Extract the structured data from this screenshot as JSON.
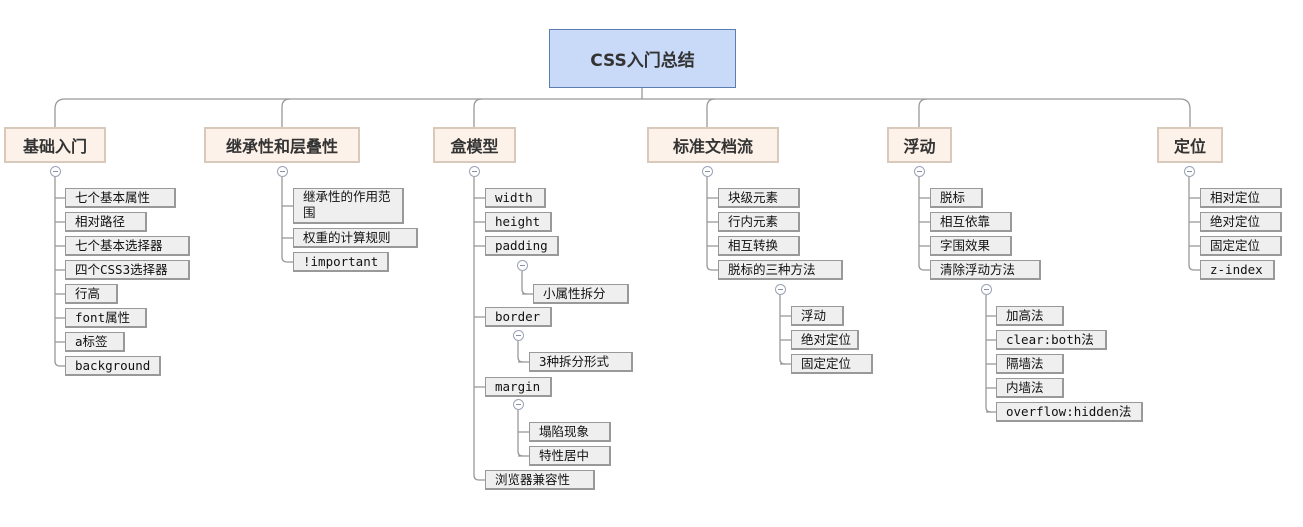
{
  "colors": {
    "root_fill": "#c9daf8",
    "branch_fill": "#fdf2e9",
    "leaf_fill": "#efefef",
    "line": "#999999"
  },
  "root": {
    "label": "CSS入门总结"
  },
  "branches": [
    {
      "label": "基础入门",
      "children": [
        {
          "label": "七个基本属性"
        },
        {
          "label": "相对路径"
        },
        {
          "label": "七个基本选择器"
        },
        {
          "label": "四个CSS3选择器"
        },
        {
          "label": "行高"
        },
        {
          "label": "font属性"
        },
        {
          "label": "a标签"
        },
        {
          "label": "background"
        }
      ]
    },
    {
      "label": "继承性和层叠性",
      "children": [
        {
          "label": "继承性的作用范围"
        },
        {
          "label": "权重的计算规则"
        },
        {
          "label": "!important"
        }
      ]
    },
    {
      "label": "盒模型",
      "children": [
        {
          "label": "width"
        },
        {
          "label": "height"
        },
        {
          "label": "padding",
          "children": [
            {
              "label": "小属性拆分"
            }
          ]
        },
        {
          "label": "border",
          "children": [
            {
              "label": "3种拆分形式"
            }
          ]
        },
        {
          "label": "margin",
          "children": [
            {
              "label": "塌陷现象"
            },
            {
              "label": "特性居中"
            }
          ]
        },
        {
          "label": "浏览器兼容性"
        }
      ]
    },
    {
      "label": "标准文档流",
      "children": [
        {
          "label": "块级元素"
        },
        {
          "label": "行内元素"
        },
        {
          "label": "相互转换"
        },
        {
          "label": "脱标的三种方法",
          "children": [
            {
              "label": "浮动"
            },
            {
              "label": "绝对定位"
            },
            {
              "label": "固定定位"
            }
          ]
        }
      ]
    },
    {
      "label": "浮动",
      "children": [
        {
          "label": "脱标"
        },
        {
          "label": "相互依靠"
        },
        {
          "label": "字围效果"
        },
        {
          "label": "清除浮动方法",
          "children": [
            {
              "label": "加高法"
            },
            {
              "label": "clear:both法"
            },
            {
              "label": "隔墙法"
            },
            {
              "label": "内墙法"
            },
            {
              "label": "overflow:hidden法"
            }
          ]
        }
      ]
    },
    {
      "label": "定位",
      "children": [
        {
          "label": "相对定位"
        },
        {
          "label": "绝对定位"
        },
        {
          "label": "固定定位"
        },
        {
          "label": "z-index"
        }
      ]
    }
  ]
}
